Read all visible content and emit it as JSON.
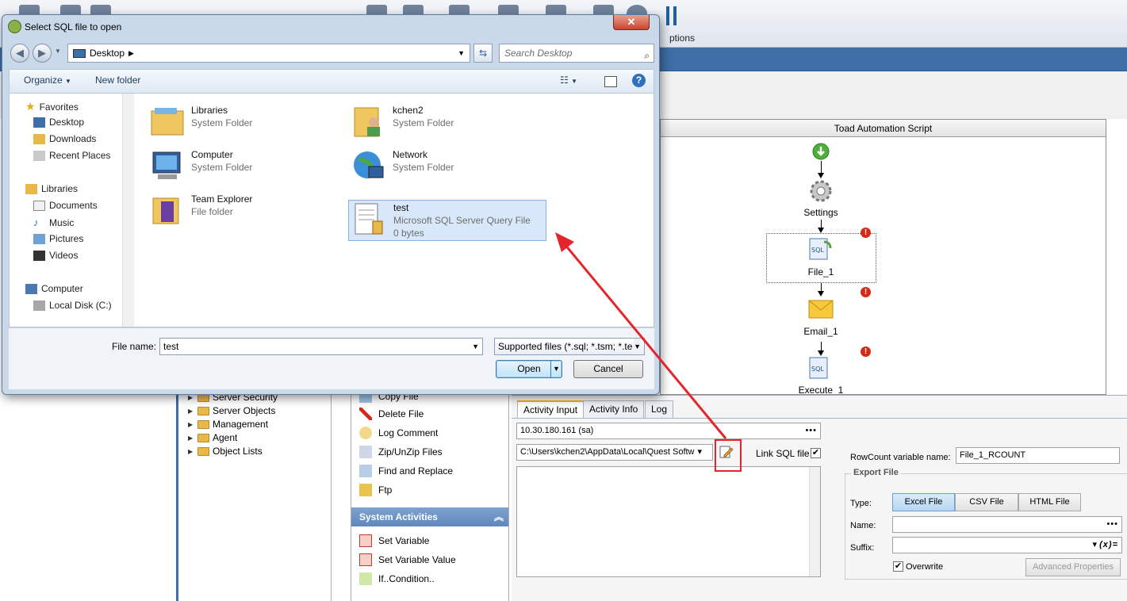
{
  "toad": {
    "options_label": "ptions",
    "script_title": "Toad Automation Script",
    "nodes": [
      {
        "label": "Settings"
      },
      {
        "label": "File_1"
      },
      {
        "label": "Email_1"
      },
      {
        "label": "Execute_1"
      }
    ],
    "tree_items": [
      "Server Security",
      "Server Objects",
      "Management",
      "Agent",
      "Object Lists"
    ],
    "activities": [
      "Copy File",
      "Delete File",
      "Log Comment",
      "Zip/UnZip Files",
      "Find and Replace",
      "Ftp"
    ],
    "system_activities_header": "System Activities",
    "system_activities": [
      "Set Variable",
      "Set Variable Value",
      "If..Condition.."
    ],
    "tabs": [
      "Activity Input",
      "Activity Info",
      "Log"
    ],
    "connection": "10.30.180.161 (sa)",
    "sql_path": "C:\\Users\\kchen2\\AppData\\Local\\Quest Softw",
    "link_sql_label": "Link SQL file",
    "rowcount_label": "RowCount variable name:",
    "rowcount_value": "File_1_RCOUNT",
    "export_legend": "Export File",
    "type_label": "Type:",
    "type_buttons": [
      "Excel File",
      "CSV File",
      "HTML File"
    ],
    "name_label": "Name:",
    "suffix_label": "Suffix:",
    "suffix_fx": "(x)=",
    "overwrite_label": "Overwrite",
    "advanced_label": "Advanced Properties",
    "dots": "•••"
  },
  "dialog": {
    "title": "Select SQL file to open",
    "close": "✕",
    "address": "Desktop",
    "search_placeholder": "Search Desktop",
    "organize": "Organize",
    "new_folder": "New folder",
    "nav": {
      "favorites": "Favorites",
      "fav_items": [
        "Desktop",
        "Downloads",
        "Recent Places"
      ],
      "libraries": "Libraries",
      "lib_items": [
        "Documents",
        "Music",
        "Pictures",
        "Videos"
      ],
      "computer": "Computer",
      "comp_items": [
        "Local Disk (C:)"
      ]
    },
    "files": [
      {
        "name": "Libraries",
        "sub": "System Folder",
        "icon": "libraries-icon"
      },
      {
        "name": "kchen2",
        "sub": "System Folder",
        "icon": "user-folder-icon"
      },
      {
        "name": "Computer",
        "sub": "System Folder",
        "icon": "computer-icon"
      },
      {
        "name": "Network",
        "sub": "System Folder",
        "icon": "network-icon"
      },
      {
        "name": "Team Explorer",
        "sub": "File folder",
        "icon": "folder-icon"
      },
      {
        "name": "test",
        "sub": "Microsoft SQL Server Query File",
        "sub2": "0 bytes",
        "icon": "sql-file-icon"
      }
    ],
    "file_name_label": "File name:",
    "file_name_value": "test",
    "file_type": "Supported files (*.sql; *.tsm; *.te",
    "open_label": "Open",
    "cancel_label": "Cancel"
  },
  "colors": {
    "annotation": "#e5252c",
    "accent": "#3d6ea6"
  }
}
